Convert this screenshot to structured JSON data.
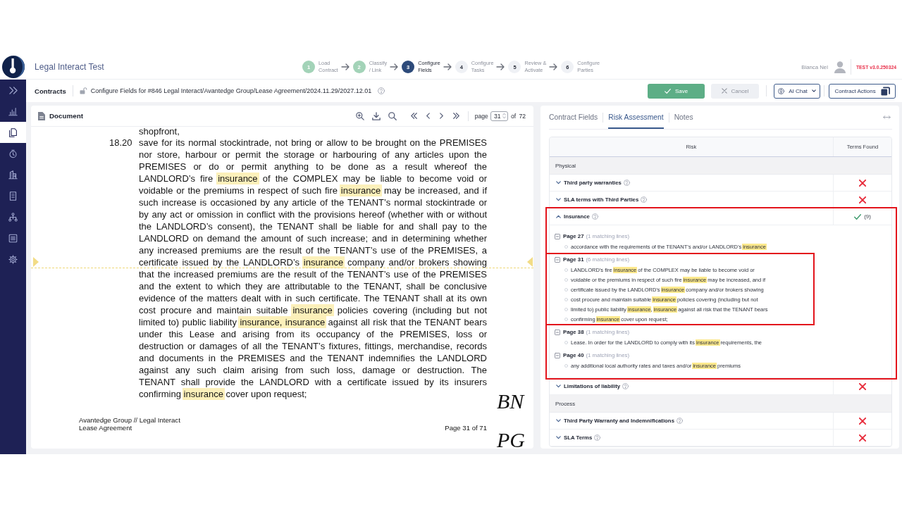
{
  "header": {
    "title": "Legal Interact Test",
    "steps": [
      {
        "number": "1",
        "label": "Load\nContract",
        "completed": true,
        "current": false
      },
      {
        "number": "2",
        "label": "Classify\n/ Link",
        "completed": true,
        "current": false
      },
      {
        "number": "3",
        "label": "Configure\nFields",
        "completed": false,
        "current": true
      },
      {
        "number": "4",
        "label": "Configure\nTasks",
        "completed": false,
        "current": false
      },
      {
        "number": "5",
        "label": "Review &\nActivate",
        "completed": false,
        "current": false
      },
      {
        "number": "6",
        "label": "Configure\nParties",
        "completed": false,
        "current": false
      }
    ],
    "user": "Bianca Nel",
    "version": "TEST v3.0.250324"
  },
  "sidebar": {
    "items": [
      {
        "selected": false
      },
      {
        "selected": true
      },
      {
        "selected": false
      },
      {
        "selected": false
      },
      {
        "selected": false
      },
      {
        "selected": false
      },
      {
        "selected": false
      },
      {
        "selected": false
      }
    ]
  },
  "toolbar": {
    "breadcrumb": "Contracts",
    "title": "Configure Fields for #846 Legal Interact/Avantedge Group/Lease Agreement/2024.11.29/2027.12.01",
    "buttons": [
      {
        "label": "Save",
        "kind": "primary"
      },
      {
        "label": "Cancel",
        "kind": "secondary"
      },
      {
        "label": "AI Chat",
        "kind": "menu"
      },
      {
        "label": "Contract Actions",
        "kind": "actions"
      }
    ]
  },
  "document": {
    "title": "Document",
    "page_label": "page",
    "page": "31",
    "page_count": "of 72",
    "page_content": {
      "continued": "shopfront,",
      "clause_number": "18.20",
      "lines": [
        {
          "current": false,
          "segments": [
            {
              "text": "save for its normal stockintrade, not bring or allow to be brought on the PREMISES",
              "highlighted": false
            }
          ]
        },
        {
          "current": false,
          "segments": [
            {
              "text": "nor store, harbour or permit the storage or harbouring of any articles upon the",
              "highlighted": false
            }
          ]
        },
        {
          "current": false,
          "segments": [
            {
              "text": "PREMISES or do or permit anything to be done as a result whereof the",
              "highlighted": false
            }
          ]
        },
        {
          "current": false,
          "segments": [
            {
              "text": "LANDLORD’s fire ",
              "highlighted": false
            },
            {
              "text": "insurance",
              "highlighted": true
            },
            {
              "text": " of the COMPLEX may be liable to become void or",
              "highlighted": false
            }
          ]
        },
        {
          "current": false,
          "segments": [
            {
              "text": "voidable or the premiums in respect of such fire ",
              "highlighted": false
            },
            {
              "text": "insurance",
              "highlighted": true
            },
            {
              "text": " may be increased, and if",
              "highlighted": false
            }
          ]
        },
        {
          "current": false,
          "segments": [
            {
              "text": "such increase is occasioned by any article of the TENANT’s normal stockintrade or",
              "highlighted": false
            }
          ]
        },
        {
          "current": false,
          "segments": [
            {
              "text": "by any act or omission in conflict with the provisions hereof (whether with or without",
              "highlighted": false
            }
          ]
        },
        {
          "current": false,
          "segments": [
            {
              "text": "the LANDLORD’s consent), the TENANT shall be liable for and shall pay to the",
              "highlighted": false
            }
          ]
        },
        {
          "current": false,
          "segments": [
            {
              "text": "LANDLORD on demand the amount of such increase; and in determining whether",
              "highlighted": false
            }
          ]
        },
        {
          "current": false,
          "segments": [
            {
              "text": "any increased premiums are the result of the TENANT’s use of the PREMISES, a",
              "highlighted": false
            }
          ]
        },
        {
          "current": true,
          "segments": [
            {
              "text": "certificate issued by the LANDLORD’s ",
              "highlighted": false
            },
            {
              "text": "insurance",
              "highlighted": true
            },
            {
              "text": " company and/or brokers showing",
              "highlighted": false
            }
          ]
        },
        {
          "current": false,
          "segments": [
            {
              "text": "that the increased premiums are the result of the TENANT’s use of the PREMISES",
              "highlighted": false
            }
          ]
        },
        {
          "current": false,
          "segments": [
            {
              "text": "and the extent to which they are attributable to the TENANT, shall be conclusive",
              "highlighted": false
            }
          ]
        },
        {
          "current": false,
          "segments": [
            {
              "text": "evidence of the matters dealt with in such certificate. The TENANT shall at its own",
              "highlighted": false
            }
          ]
        },
        {
          "current": false,
          "segments": [
            {
              "text": "cost procure and maintain suitable ",
              "highlighted": false
            },
            {
              "text": "insurance",
              "highlighted": true
            },
            {
              "text": " policies covering (including but not",
              "highlighted": false
            }
          ]
        },
        {
          "current": false,
          "segments": [
            {
              "text": "limited to) public liability ",
              "highlighted": false
            },
            {
              "text": "insurance, insurance",
              "highlighted": true
            },
            {
              "text": " against all risk that the TENANT bears",
              "highlighted": false
            }
          ]
        },
        {
          "current": false,
          "segments": [
            {
              "text": "under this Lease and arising from its occupancy of the PREMISES, loss or",
              "highlighted": false
            }
          ]
        },
        {
          "current": false,
          "segments": [
            {
              "text": "destruction or damages of all the TENANT’s fixtures, fittings, merchandise, records",
              "highlighted": false
            }
          ]
        },
        {
          "current": false,
          "segments": [
            {
              "text": "and documents in the PREMISES and the TENANT indemnifies the LANDLORD",
              "highlighted": false
            }
          ]
        },
        {
          "current": false,
          "segments": [
            {
              "text": "against any such claim arising from such loss, damage or destruction. The",
              "highlighted": false
            }
          ]
        },
        {
          "current": false,
          "segments": [
            {
              "text": "TENANT shall provide the LANDLORD with a certificate issued by its insurers",
              "highlighted": false
            }
          ]
        },
        {
          "current": false,
          "segments": [
            {
              "text": "confirming ",
              "highlighted": false
            },
            {
              "text": "insurance",
              "highlighted": true
            },
            {
              "text": " cover upon request;",
              "highlighted": false
            }
          ]
        }
      ],
      "footer_left": "Avantedge Group // Legal Interact\nLease Agreement",
      "footer_right": "Page 31 of 71",
      "initials": [
        "BN",
        "PG"
      ]
    }
  },
  "risk_panel": {
    "tabs": [
      {
        "label": "Contract Fields",
        "selected": false
      },
      {
        "label": "Risk Assessment",
        "selected": true
      },
      {
        "label": "Notes",
        "selected": false
      }
    ],
    "table": {
      "columns": [
        "Risk",
        "Terms Found"
      ],
      "sections": [
        {
          "name": "Physical",
          "risks": [
            {
              "name": "Third party warranties",
              "expanded": false,
              "found": false,
              "outlined": false
            },
            {
              "name": "SLA terms with Third Parties",
              "expanded": false,
              "found": false,
              "outlined": false
            },
            {
              "name": "Insurance",
              "expanded": true,
              "found": true,
              "count": "(9)",
              "outlined": true,
              "pages": [
                {
                  "page": "Page 27",
                  "matches": "(1 matching lines)",
                  "expanded": true,
                  "outlined": false,
                  "lines": [
                    {
                      "segments": [
                        {
                          "text": "accordance with the requirements of the TENANT’s and/or LANDLORD’s ",
                          "highlighted": false
                        },
                        {
                          "text": "insurance",
                          "highlighted": true
                        }
                      ]
                    }
                  ]
                },
                {
                  "page": "Page 31",
                  "matches": "(6 matching lines)",
                  "expanded": true,
                  "outlined": true,
                  "lines": [
                    {
                      "segments": [
                        {
                          "text": "LANDLORD’s fire ",
                          "highlighted": false
                        },
                        {
                          "text": "insurance",
                          "highlighted": true
                        },
                        {
                          "text": " of the COMPLEX may be liable to become void or",
                          "highlighted": false
                        }
                      ]
                    },
                    {
                      "segments": [
                        {
                          "text": "voidable or the premiums in respect of such fire ",
                          "highlighted": false
                        },
                        {
                          "text": "insurance",
                          "highlighted": true
                        },
                        {
                          "text": " may be increased, and if",
                          "highlighted": false
                        }
                      ]
                    },
                    {
                      "segments": [
                        {
                          "text": "certificate issued by the LANDLORD’s ",
                          "highlighted": false
                        },
                        {
                          "text": "insurance",
                          "highlighted": true
                        },
                        {
                          "text": " company and/or brokers showing",
                          "highlighted": false
                        }
                      ]
                    },
                    {
                      "segments": [
                        {
                          "text": "cost procure and maintain suitable ",
                          "highlighted": false
                        },
                        {
                          "text": "insurance",
                          "highlighted": true
                        },
                        {
                          "text": " policies covering (including but not",
                          "highlighted": false
                        }
                      ]
                    },
                    {
                      "segments": [
                        {
                          "text": "limited to) public liability ",
                          "highlighted": false
                        },
                        {
                          "text": "insurance",
                          "highlighted": true
                        },
                        {
                          "text": ", ",
                          "highlighted": false
                        },
                        {
                          "text": "insurance",
                          "highlighted": true
                        },
                        {
                          "text": " against all risk that the TENANT bears",
                          "highlighted": false
                        }
                      ]
                    },
                    {
                      "segments": [
                        {
                          "text": "confirming ",
                          "highlighted": false
                        },
                        {
                          "text": "insurance",
                          "highlighted": true
                        },
                        {
                          "text": " cover upon request;",
                          "highlighted": false
                        }
                      ]
                    }
                  ]
                },
                {
                  "page": "Page 38",
                  "matches": "(1 matching lines)",
                  "expanded": true,
                  "outlined": false,
                  "lines": [
                    {
                      "segments": [
                        {
                          "text": "Lease. In order for the LANDLORD to comply with its ",
                          "highlighted": false
                        },
                        {
                          "text": "insurance",
                          "highlighted": true
                        },
                        {
                          "text": " requirements, the",
                          "highlighted": false
                        }
                      ]
                    }
                  ]
                },
                {
                  "page": "Page 40",
                  "matches": "(1 matching lines)",
                  "expanded": true,
                  "outlined": false,
                  "lines": [
                    {
                      "segments": [
                        {
                          "text": "any additional local authority rates and taxes and/or ",
                          "highlighted": false
                        },
                        {
                          "text": "insurance",
                          "highlighted": true
                        },
                        {
                          "text": " premiums",
                          "highlighted": false
                        }
                      ]
                    }
                  ]
                }
              ]
            },
            {
              "name": "Limitations of liability",
              "expanded": false,
              "found": false,
              "outlined": false
            }
          ]
        },
        {
          "name": "Process",
          "risks": [
            {
              "name": "Third Party Warranty and Indemnifications",
              "expanded": false,
              "found": false,
              "outlined": false
            },
            {
              "name": "SLA Terms",
              "expanded": false,
              "found": false,
              "outlined": false
            }
          ]
        }
      ]
    }
  }
}
